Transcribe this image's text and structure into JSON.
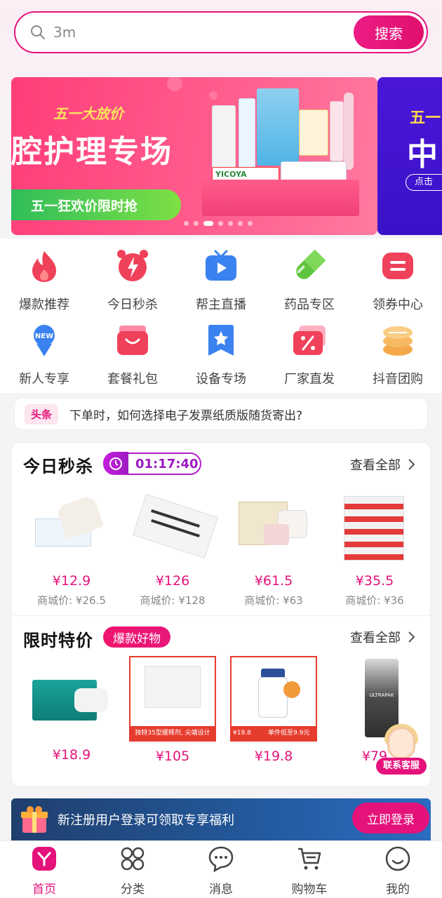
{
  "search": {
    "value": "3m",
    "button_label": "搜索"
  },
  "banner": {
    "tag": "五一大放价",
    "title": "腔护理专场",
    "pill": "五一狂欢价限时抢",
    "box_label": "YICOYA",
    "slide_count": 7,
    "active_slide": 3,
    "next_banner_tag": "五一",
    "next_banner_title": "中",
    "next_banner_pill": "点击"
  },
  "categories": [
    {
      "label": "爆款推荐",
      "icon": "flame-icon",
      "color": "#f0415a"
    },
    {
      "label": "今日秒杀",
      "icon": "alarm-clock-icon",
      "color": "#f0415a"
    },
    {
      "label": "帮主直播",
      "icon": "tv-play-icon",
      "color": "#3a82f0"
    },
    {
      "label": "药品专区",
      "icon": "capsule-icon",
      "color": "#5fc53e"
    },
    {
      "label": "领券中心",
      "icon": "coupon-icon",
      "color": "#f0415a"
    },
    {
      "label": "新人专享",
      "icon": "new-user-icon",
      "color": "#3a82f0"
    },
    {
      "label": "套餐礼包",
      "icon": "gift-bag-icon",
      "color": "#f0415a"
    },
    {
      "label": "设备专场",
      "icon": "star-bookmark-icon",
      "color": "#3a82f0"
    },
    {
      "label": "厂家直发",
      "icon": "discount-ticket-icon",
      "color": "#f0415a"
    },
    {
      "label": "抖音团购",
      "icon": "coin-stack-icon",
      "color": "#f5a84a"
    }
  ],
  "news": {
    "chip": "头条",
    "text": "下单时，如何选择电子发票纸质版随货寄出?"
  },
  "flash_sale": {
    "title": "今日秒杀",
    "countdown": "01:17:40",
    "more_label": "查看全部",
    "items": [
      {
        "price": "¥12.9",
        "mall_price": "商城价: ¥26.5"
      },
      {
        "price": "¥126",
        "mall_price": "商城价: ¥128"
      },
      {
        "price": "¥61.5",
        "mall_price": "商城价: ¥63"
      },
      {
        "price": "¥35.5",
        "mall_price": "商城价: ¥36"
      }
    ]
  },
  "special": {
    "title": "限时特价",
    "tag": "爆款好物",
    "more_label": "查看全部",
    "items": [
      {
        "price": "¥18.9"
      },
      {
        "price": "¥105",
        "caption": "独特35型缓释剂, 尖端设计"
      },
      {
        "price": "¥19.8",
        "badge": "¥19.8",
        "caption": "单件低至9.9元"
      },
      {
        "price": "¥79",
        "caption": "ULTRAPAK"
      }
    ]
  },
  "service": {
    "label": "联系客服"
  },
  "login_bar": {
    "text": "新注册用户登录可领取专享福利",
    "button_label": "立即登录"
  },
  "tabbar": [
    {
      "label": "首页",
      "icon": "home-icon",
      "active": true
    },
    {
      "label": "分类",
      "icon": "category-grid-icon",
      "active": false
    },
    {
      "label": "消息",
      "icon": "chat-bubble-icon",
      "active": false
    },
    {
      "label": "购物车",
      "icon": "cart-icon",
      "active": false
    },
    {
      "label": "我的",
      "icon": "smile-profile-icon",
      "active": false
    }
  ],
  "colors": {
    "accent": "#e5127b",
    "timer_purple": "#9c1ac0"
  }
}
